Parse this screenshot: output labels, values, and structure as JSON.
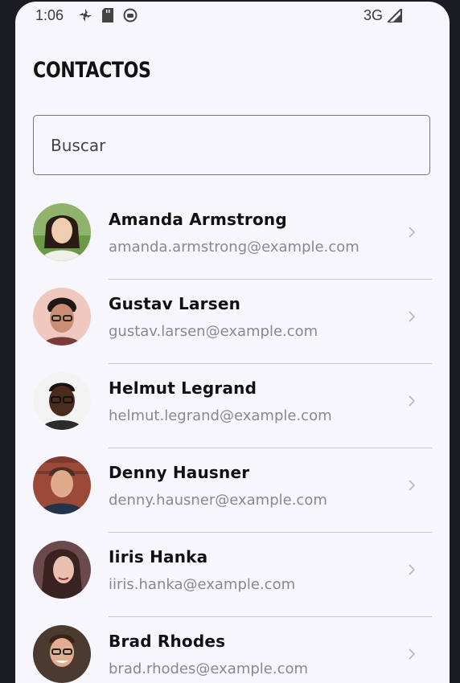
{
  "status_bar": {
    "time": "1:06",
    "network": "3G",
    "icons": [
      "fan-icon",
      "sd-card-icon",
      "robot-icon",
      "signal-icon"
    ]
  },
  "header": {
    "title": "CONTACTOS"
  },
  "search": {
    "placeholder": "Buscar",
    "value": ""
  },
  "contacts": [
    {
      "name": "Amanda Armstrong",
      "email": "amanda.armstrong@example.com"
    },
    {
      "name": "Gustav Larsen",
      "email": "gustav.larsen@example.com"
    },
    {
      "name": "Helmut Legrand",
      "email": "helmut.legrand@example.com"
    },
    {
      "name": "Denny Hausner",
      "email": "denny.hausner@example.com"
    },
    {
      "name": "Iiris Hanka",
      "email": "iiris.hanka@example.com"
    },
    {
      "name": "Brad Rhodes",
      "email": "brad.rhodes@example.com"
    }
  ],
  "colors": {
    "background": "#f8f6fd",
    "name_text": "#111111",
    "email_text": "#8a8790",
    "divider": "#c9c6cc"
  }
}
